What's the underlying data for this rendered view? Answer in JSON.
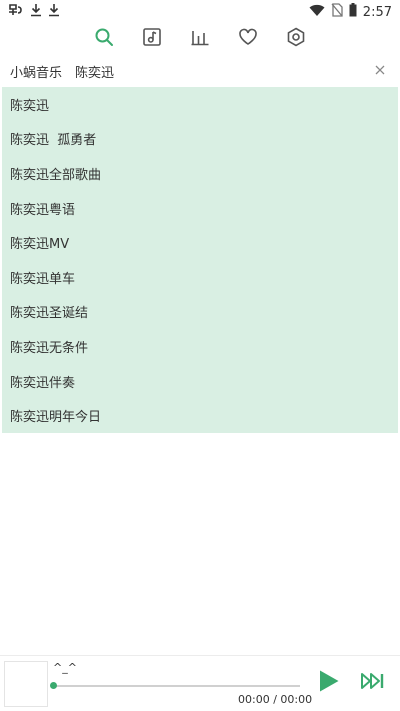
{
  "status_bar": {
    "time": "2:57",
    "left_icons": [
      "bug-notification-icon",
      "download-icon",
      "download-icon"
    ],
    "right_icons": [
      "wifi-icon",
      "no-sim-icon",
      "battery-icon"
    ]
  },
  "toolbar": {
    "accent_color": "#3aaa6e",
    "icon_color": "#555555",
    "items": [
      {
        "name": "search",
        "icon": "search-icon",
        "active": true
      },
      {
        "name": "playlist",
        "icon": "music-playlist-icon",
        "active": false
      },
      {
        "name": "charts",
        "icon": "bar-chart-icon",
        "active": false
      },
      {
        "name": "favorites",
        "icon": "heart-icon",
        "active": false
      },
      {
        "name": "settings",
        "icon": "settings-hexagon-icon",
        "active": false
      }
    ]
  },
  "search": {
    "source": "小蜗音乐",
    "query": "陈奕迅",
    "clear_icon": "close-icon"
  },
  "suggestions": {
    "background": "#d9efe3",
    "items": [
      "陈奕迅",
      "陈奕迅  孤勇者",
      "陈奕迅全部歌曲",
      "陈奕迅粤语",
      "陈奕迅MV",
      "陈奕迅单车",
      "陈奕迅圣诞结",
      "陈奕迅无条件",
      "陈奕迅伴奏",
      "陈奕迅明年今日"
    ]
  },
  "player": {
    "title": "^_^",
    "time": "00:00 / 00:00",
    "progress": 0,
    "accent_color": "#3aaa6e"
  }
}
